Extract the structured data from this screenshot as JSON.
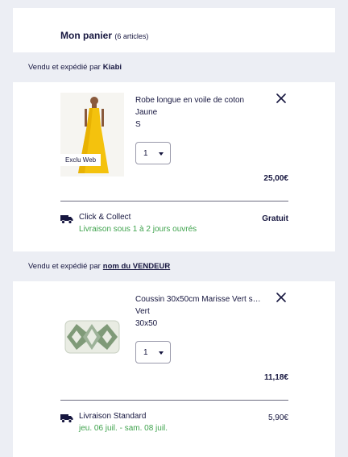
{
  "cart": {
    "title": "Mon panier",
    "count": "(6 articles)"
  },
  "sellers": [
    {
      "prefix": "Vendu et expédié par",
      "name": "Kiabi",
      "product": {
        "name": "Robe longue en voile de coton",
        "color": "Jaune",
        "size": "S",
        "badge": "Exclu Web",
        "quantity": "1",
        "price": "25,00€"
      },
      "shipping": {
        "name": "Click & Collect",
        "delay": "Livraison sous 1 à 2 jours ouvrés",
        "price": "Gratuit"
      }
    },
    {
      "prefix": "Vendu et expédié par",
      "name": "nom du VENDEUR",
      "product": {
        "name": "Coussin 30x50cm Marisse Vert s…",
        "color": "Vert",
        "size": "30x50",
        "quantity": "1",
        "price": "11,18€"
      },
      "shipping": {
        "name": "Livraison Standard",
        "delay": "jeu. 06 juil. - sam. 08 juil.",
        "price": "5,90€"
      }
    }
  ],
  "icons": [
    "close-icon",
    "truck-icon",
    "caret-down-icon"
  ],
  "colors": {
    "text": "#16163f",
    "delivery_green": "#3fa34d",
    "band_bg": "#eceef4",
    "dress_yellow": "#f4c20d"
  }
}
